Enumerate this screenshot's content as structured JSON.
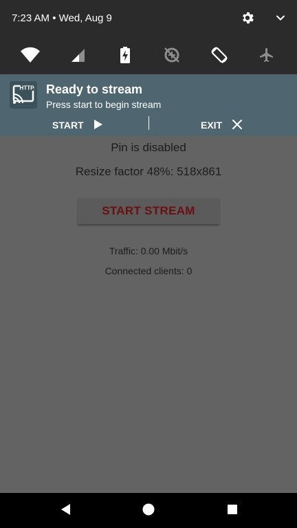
{
  "status_bar": {
    "time_date": "7:23 AM • Wed, Aug 9",
    "icons": [
      "gear-icon",
      "chevron-down-icon"
    ]
  },
  "quick_tiles": [
    "wifi-icon",
    "cell-signal-icon",
    "battery-charging-icon",
    "data-saver-off-icon",
    "auto-rotate-icon",
    "airplane-mode-icon"
  ],
  "notification": {
    "app_icon": "http-cast-icon",
    "title": "Ready to stream",
    "text": "Press start to begin stream",
    "start_label": "START",
    "exit_label": "EXIT"
  },
  "main": {
    "pin_status": "Pin is disabled",
    "resize_info": "Resize factor 48%: 518x861",
    "start_button_label": "START STREAM",
    "traffic": "Traffic: 0.00 Mbit/s",
    "clients": "Connected clients: 0"
  },
  "nav_bar": [
    "back-icon",
    "home-icon",
    "recents-icon"
  ],
  "colors": {
    "shade_bg": "#2b2b2b",
    "notification_bg": "#4f6670",
    "content_bg": "#636363",
    "start_stream_text": "#6b0f12"
  }
}
